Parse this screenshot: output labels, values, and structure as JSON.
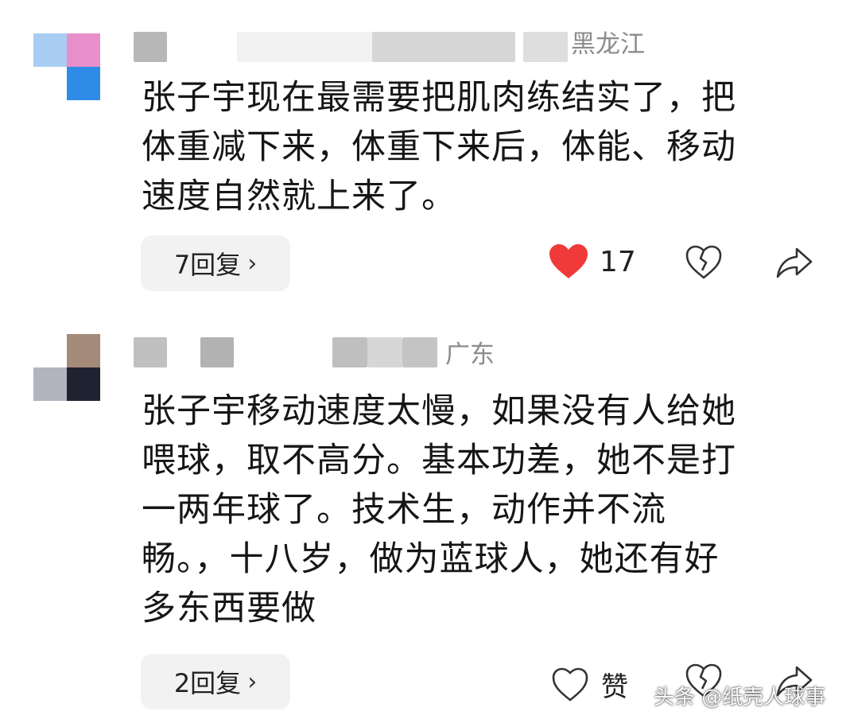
{
  "comments": [
    {
      "location": "黑龙江",
      "text_lines": [
        "张子宇现在最需要把肌肉练结实了，把",
        "体重减下来，体重下来后，体能、移动",
        "速度自然就上来了。"
      ],
      "reply_label": "7回复",
      "like_count": "17",
      "liked": true
    },
    {
      "location": "广东",
      "text_lines": [
        "张子宇移动速度太慢，如果没有人给她",
        "喂球，取不高分。基本功差，她不是打",
        "一两年球了。技术生，动作并不流",
        "畅。，十八岁，做为蓝球人，她还有好",
        "多东西要做"
      ],
      "reply_label": "2回复",
      "like_label": "赞",
      "liked": false
    }
  ],
  "icons": {
    "reply_chevron": "chevron-right-icon",
    "like_filled": "heart-filled-icon",
    "like_outline": "heart-outline-icon",
    "dislike": "broken-heart-icon",
    "share": "share-arrow-icon"
  },
  "colors": {
    "like_red": "#f03a3a",
    "location_gray": "#8c8c8c",
    "reply_bg": "#f2f2f2"
  },
  "watermark": "头条 @纸壳人球事"
}
